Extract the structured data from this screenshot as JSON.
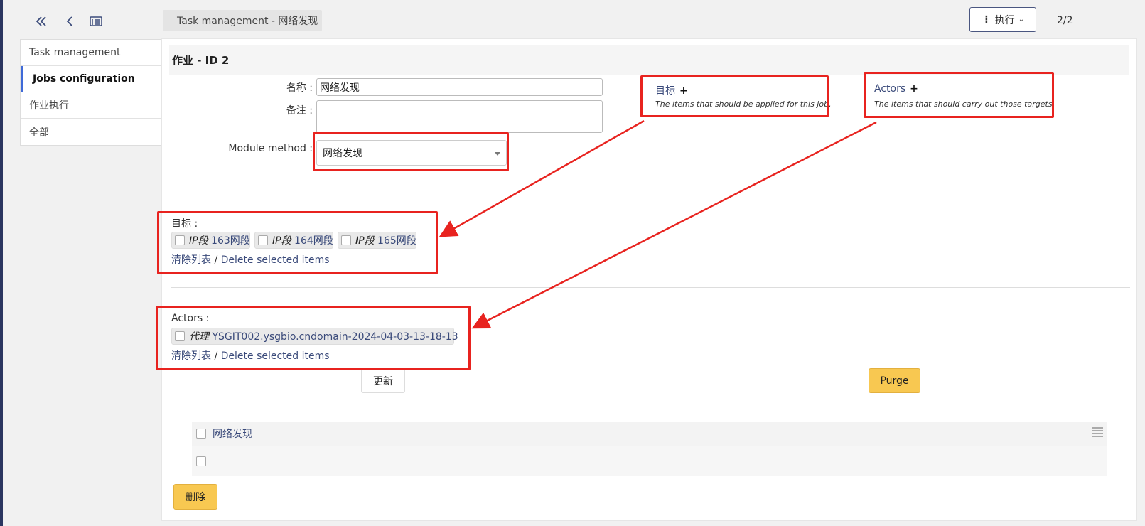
{
  "toolbar": {
    "breadcrumb": "Task management - 网络发现",
    "exec_label": "执行",
    "page_count": "2/2"
  },
  "sidebar": {
    "items": [
      {
        "label": "Task management"
      },
      {
        "label": "Jobs configuration"
      },
      {
        "label": "作业执行"
      },
      {
        "label": "全部"
      }
    ]
  },
  "form": {
    "header": "作业 - ID 2",
    "name_label": "名称 :",
    "name_value": "网络发现",
    "note_label": "备注 :",
    "note_value": "",
    "module_label": "Module method :",
    "module_value": "网络发现"
  },
  "right_panels": {
    "targets_title": "目标",
    "targets_plus": "+",
    "targets_desc": "The items that should be applied for this job.",
    "actors_title": "Actors",
    "actors_plus": "+",
    "actors_desc": "The items that should carry out those targets."
  },
  "targets": {
    "label": "目标 :",
    "items": [
      {
        "type": "IP段",
        "name": "163网段"
      },
      {
        "type": "IP段",
        "name": "164网段"
      },
      {
        "type": "IP段",
        "name": "165网段"
      }
    ],
    "clear": "清除列表",
    "sep": "/",
    "delete": "Delete selected items"
  },
  "actors": {
    "label": "Actors :",
    "items": [
      {
        "type": "代理",
        "name": "YSGIT002.ysgbio.cndomain-2024-04-03-13-18-13"
      }
    ],
    "clear": "清除列表",
    "sep": "/",
    "delete": "Delete selected items"
  },
  "buttons": {
    "update": "更新",
    "purge": "Purge",
    "delete": "删除"
  },
  "table": {
    "column": "网络发现"
  },
  "colors": {
    "annotation_red": "#e8231f",
    "accent_yellow": "#f8c851",
    "link_blue": "#3a4a7a"
  }
}
